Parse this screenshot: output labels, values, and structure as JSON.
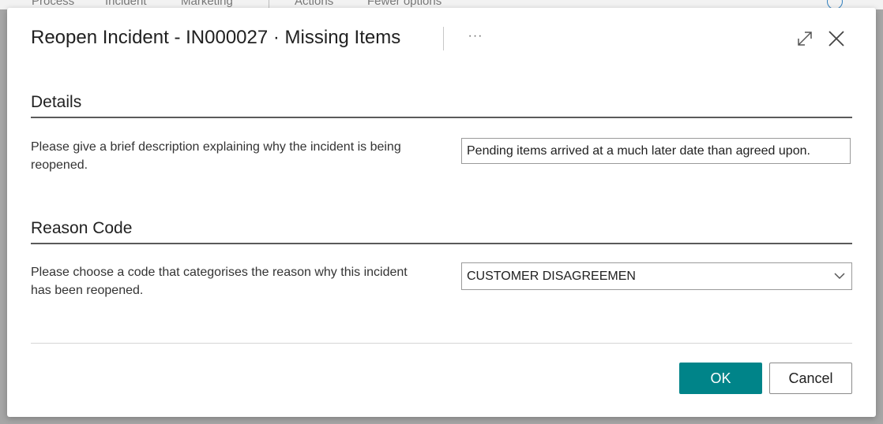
{
  "background": {
    "action_bar": [
      "Process",
      "Incident",
      "Marketing",
      "Actions",
      "Fewer options"
    ]
  },
  "dialog": {
    "title": "Reopen Incident - IN000027 · Missing Items",
    "more_label": "···",
    "sections": {
      "details": {
        "heading": "Details",
        "label": "Please give a brief description explaining why the incident is being reopened.",
        "value": "Pending items arrived at a much later date than agreed upon."
      },
      "reason": {
        "heading": "Reason Code",
        "label": "Please choose a code that categorises the reason why this incident has been reopened.",
        "selected": "CUSTOMER DISAGREEMEN"
      }
    },
    "buttons": {
      "ok": "OK",
      "cancel": "Cancel"
    }
  },
  "colors": {
    "primary": "#008489",
    "overlay": "#a6a6a6"
  }
}
